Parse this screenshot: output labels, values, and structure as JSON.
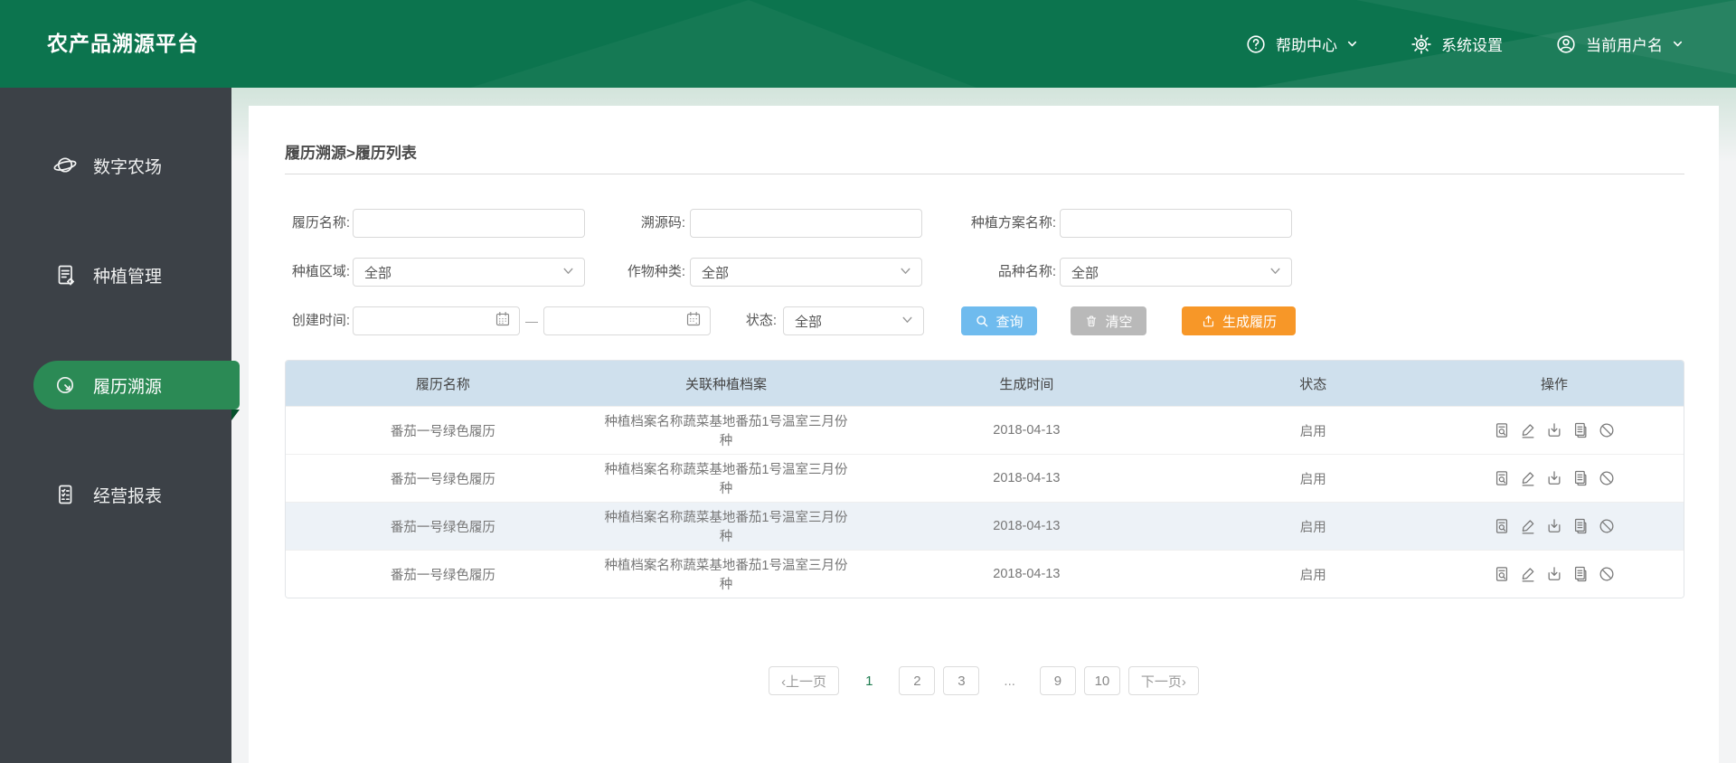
{
  "header": {
    "title": "农产品溯源平台",
    "help_label": "帮助中心",
    "settings_label": "系统设置",
    "user_label": "当前用户名"
  },
  "sidebar": {
    "items": [
      {
        "label": "数字农场",
        "icon": "farm-planet-icon",
        "active": false
      },
      {
        "label": "种植管理",
        "icon": "planting-doc-gear-icon",
        "active": false
      },
      {
        "label": "履历溯源",
        "icon": "trace-clock-icon",
        "active": true
      },
      {
        "label": "经营报表",
        "icon": "report-checklist-icon",
        "active": false
      }
    ]
  },
  "breadcrumb": "履历溯源>履历列表",
  "filters": {
    "name_label": "履历名称:",
    "code_label": "溯源码:",
    "plan_label": "种植方案名称:",
    "region_label": "种植区域:",
    "region_value": "全部",
    "crop_label": "作物种类:",
    "crop_value": "全部",
    "variety_label": "品种名称:",
    "variety_value": "全部",
    "date_label": "创建时间:",
    "date_separator": "—",
    "status_label": "状态:",
    "status_value": "全部",
    "search_button": "查询",
    "clear_button": "清空",
    "generate_button": "生成履历"
  },
  "table": {
    "headers": [
      "履历名称",
      "关联种植档案",
      "生成时间",
      "状态",
      "操作"
    ],
    "op_icons": [
      "doc-preview-icon",
      "edit-pencil-icon",
      "download-icon",
      "copy-doc-icon",
      "ban-icon"
    ],
    "rows": [
      {
        "name": "番茄一号绿色履历",
        "archive": "种植档案名称蔬菜基地番茄1号温室三月份种",
        "date": "2018-04-13",
        "status": "启用"
      },
      {
        "name": "番茄一号绿色履历",
        "archive": "种植档案名称蔬菜基地番茄1号温室三月份种",
        "date": "2018-04-13",
        "status": "启用"
      },
      {
        "name": "番茄一号绿色履历",
        "archive": "种植档案名称蔬菜基地番茄1号温室三月份种",
        "date": "2018-04-13",
        "status": "启用"
      },
      {
        "name": "番茄一号绿色履历",
        "archive": "种植档案名称蔬菜基地番茄1号温室三月份种",
        "date": "2018-04-13",
        "status": "启用"
      }
    ]
  },
  "pagination": {
    "prev": "‹上一页",
    "pages": [
      "1",
      "2",
      "3",
      "...",
      "9",
      "10"
    ],
    "current": "1",
    "next": "下一页›"
  },
  "colors": {
    "brand_green": "#0C744E",
    "sidebar_dark": "#3C4147",
    "active_green": "#2B8A55",
    "table_header_blue": "#CFE0ED",
    "search_blue": "#6FBBEE",
    "clear_gray": "#B9B9B9",
    "generate_orange": "#F79728",
    "pagination_current_green": "#1E7B4F"
  }
}
